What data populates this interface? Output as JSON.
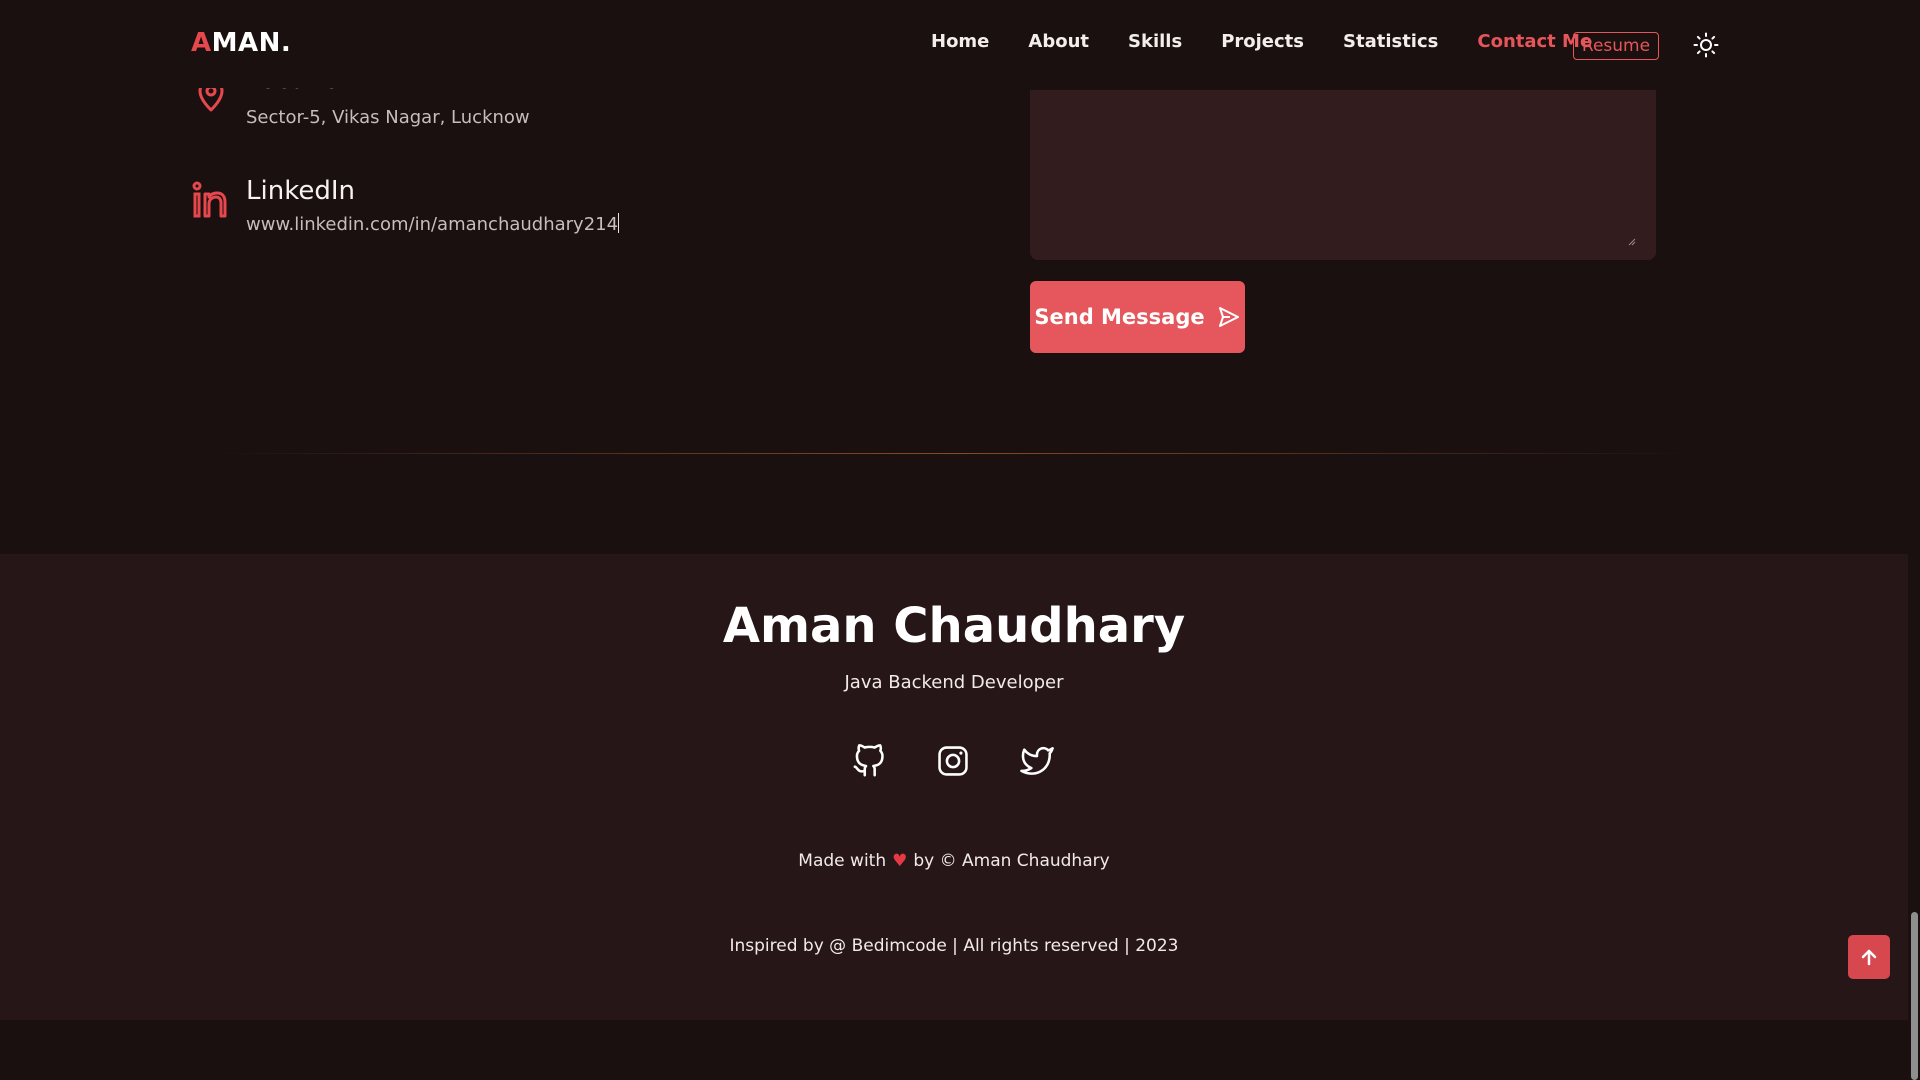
{
  "header": {
    "logo_accent": "A",
    "logo_rest": "MAN.",
    "nav": [
      {
        "label": "Home"
      },
      {
        "label": "About"
      },
      {
        "label": "Skills"
      },
      {
        "label": "Projects"
      },
      {
        "label": "Statistics"
      },
      {
        "label": "Contact Me",
        "active": true
      }
    ],
    "resume_label": "Resume",
    "theme_icon": "sun-icon"
  },
  "contact": {
    "location": {
      "title": "Location",
      "value": "Sector-5, Vikas Nagar, Lucknow",
      "icon": "location-pin-icon"
    },
    "linkedin": {
      "title": "LinkedIn",
      "value": "www.linkedin.com/in/amanchaudhary214",
      "icon": "linkedin-icon"
    }
  },
  "form": {
    "message_value": "",
    "send_label": "Send Message",
    "send_icon": "send-icon"
  },
  "footer": {
    "name": "Aman Chaudhary",
    "role": "Java Backend Developer",
    "socials": [
      "github-icon",
      "instagram-icon",
      "twitter-icon"
    ],
    "made_with_prefix": "Made with",
    "made_with_suffix": "by © Aman Chaudhary",
    "inspired": "Inspired by @ Bedimcode | All rights reserved | 2023"
  },
  "colors": {
    "accent": "#e5484d",
    "background": "#1a1010",
    "footer_background": "#261617",
    "textarea_background": "#331c1e"
  }
}
